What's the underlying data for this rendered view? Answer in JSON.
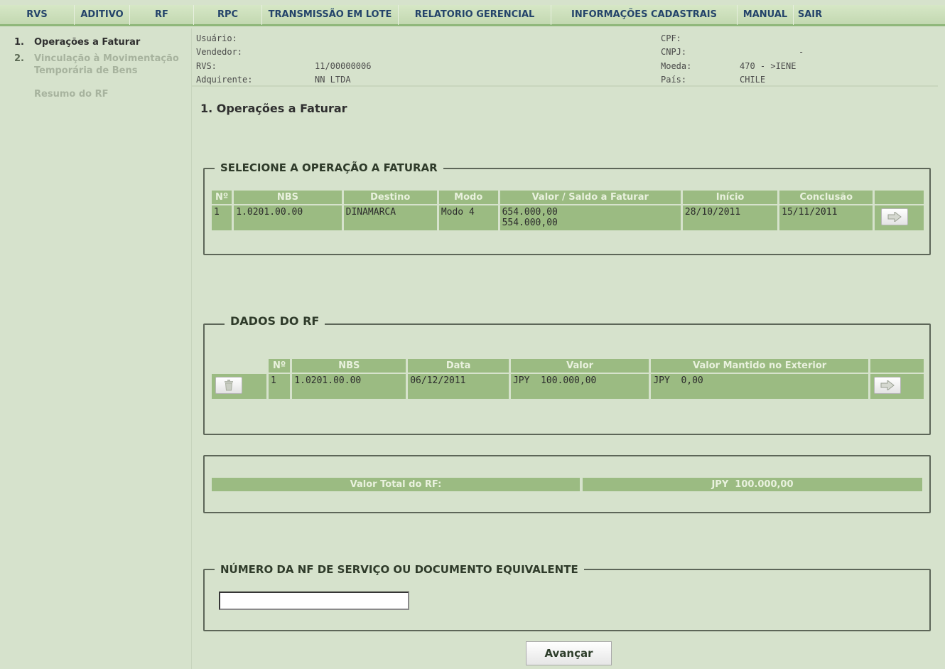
{
  "menu": {
    "items": [
      "RVS",
      "ADITIVO",
      "RF",
      "RPC",
      "TRANSMISSÃO EM LOTE",
      "RELATORIO GERENCIAL",
      "INFORMAÇÕES CADASTRAIS",
      "MANUAL",
      "SAIR"
    ]
  },
  "sidebar": {
    "items": [
      {
        "num": "1.",
        "label": "Operações a Faturar"
      },
      {
        "num": "2.",
        "label": "Vinculação à Movimentação Temporária de Bens"
      },
      {
        "num": "",
        "label": "Resumo do RF"
      }
    ]
  },
  "info": {
    "usuario_label": "Usuário:",
    "vendedor_label": "Vendedor:",
    "rvs_label": "RVS:",
    "rvs_value": "11/00000006",
    "adquirente_label": "Adquirente:",
    "adquirente_value": "NN LTDA",
    "cpf_label": "CPF:",
    "cnpj_label": "CNPJ:",
    "cnpj_value": "-",
    "moeda_label": "Moeda:",
    "moeda_value": "470 - >IENE",
    "pais_label": "País:",
    "pais_value": "CHILE"
  },
  "page_title": "1. Operações a Faturar",
  "operacoes": {
    "legend": "SELECIONE A OPERAÇÃO A FATURAR",
    "headers": [
      "Nº",
      "NBS",
      "Destino",
      "Modo",
      "Valor / Saldo a Faturar",
      "Início",
      "Conclusão"
    ],
    "rows": [
      {
        "no": "1",
        "nbs": "1.0201.00.00",
        "destino": "DINAMARCA",
        "modo": "Modo 4",
        "valor": "654.000,00",
        "saldo": "554.000,00",
        "inicio": "28/10/2011",
        "conclusao": "15/11/2011"
      }
    ]
  },
  "dados_rf": {
    "legend": "DADOS DO RF",
    "headers": [
      "Nº",
      "NBS",
      "Data",
      "Valor",
      "Valor Mantido no Exterior"
    ],
    "rows": [
      {
        "no": "1",
        "nbs": "1.0201.00.00",
        "data": "06/12/2011",
        "valor": "JPY  100.000,00",
        "mantido": "JPY  0,00"
      }
    ]
  },
  "total": {
    "label": "Valor Total do RF:",
    "value": "JPY  100.000,00"
  },
  "nf": {
    "legend": "NÚMERO DA NF DE SERVIÇO OU DOCUMENTO EQUIVALENTE",
    "value": ""
  },
  "avancar_label": "Avançar"
}
